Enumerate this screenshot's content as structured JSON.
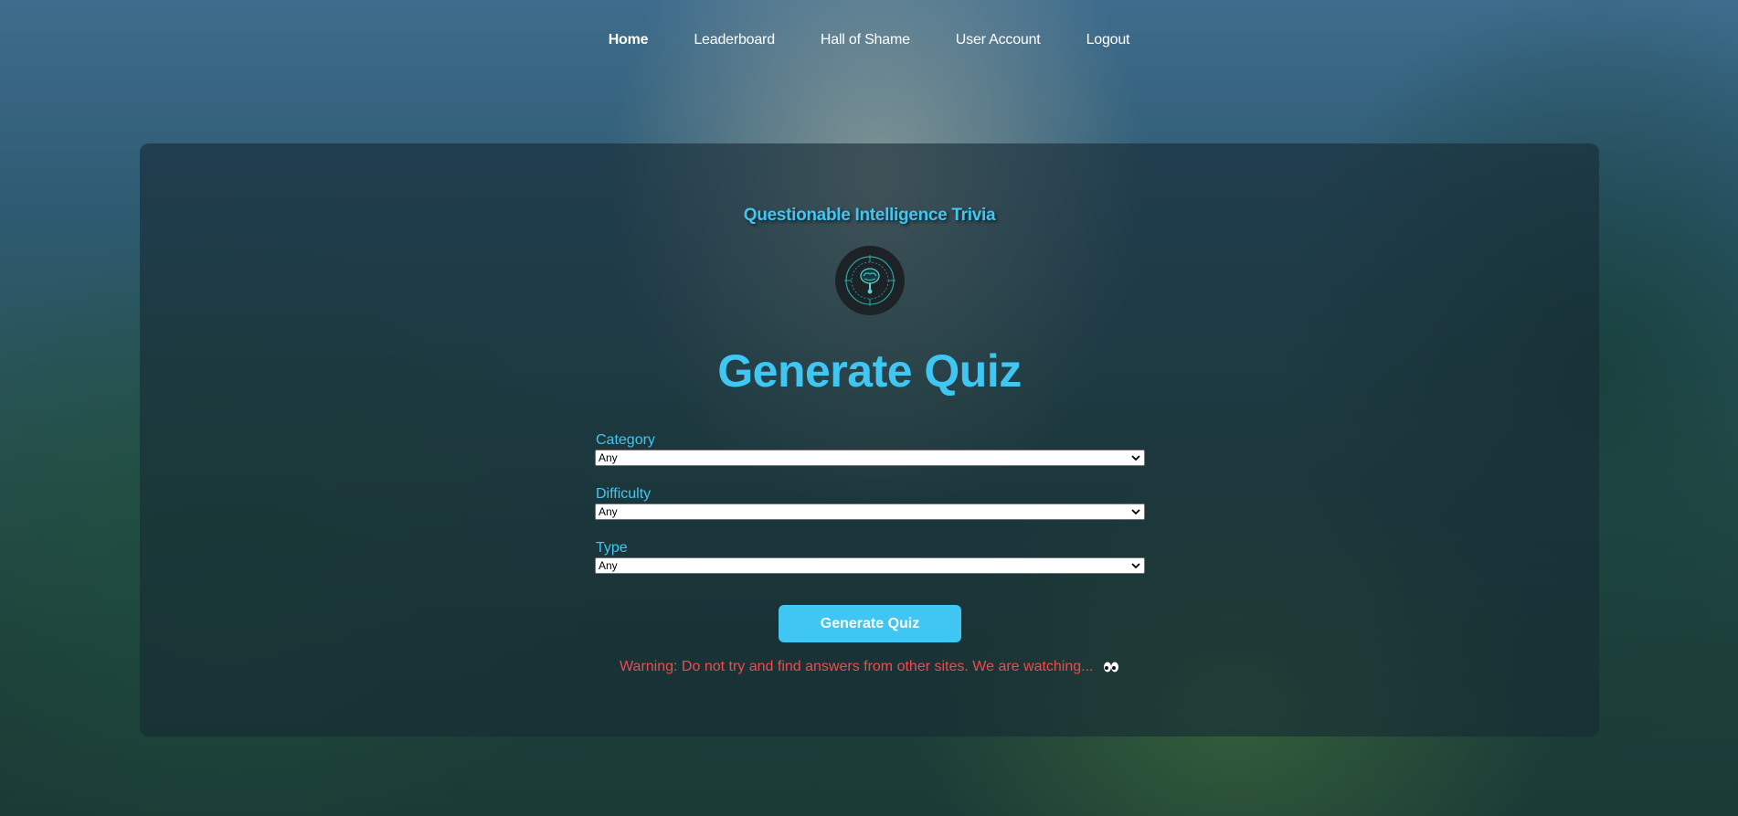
{
  "nav": {
    "items": [
      {
        "label": "Home"
      },
      {
        "label": "Leaderboard"
      },
      {
        "label": "Hall of Shame"
      },
      {
        "label": "User Account"
      },
      {
        "label": "Logout"
      }
    ]
  },
  "brand": {
    "name": "Questionable Intelligence Trivia"
  },
  "page": {
    "title": "Generate Quiz"
  },
  "form": {
    "category": {
      "label": "Category",
      "value": "Any"
    },
    "difficulty": {
      "label": "Difficulty",
      "value": "Any"
    },
    "type": {
      "label": "Type",
      "value": "Any"
    },
    "submit_label": "Generate Quiz"
  },
  "warning": {
    "text": "Warning: Do not try and find answers from other sites. We are watching...",
    "icon": "eyes-icon"
  },
  "colors": {
    "accent": "#3fc6f2",
    "warning": "#ee4c4c",
    "panel": "#162a34"
  }
}
